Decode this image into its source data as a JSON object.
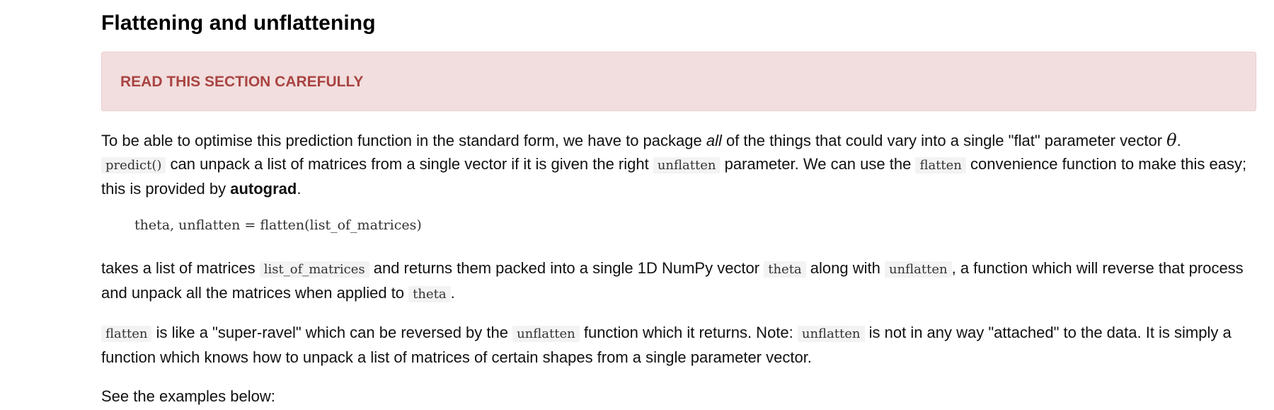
{
  "section": {
    "title": "Flattening and unflattening"
  },
  "alert": {
    "text": "READ THIS SECTION CAREFULLY"
  },
  "paragraph1": {
    "t1": "To be able to optimise this prediction function in the standard form, we have to package ",
    "em1": "all",
    "t2": " of the things that could vary into a single \"flat\" parameter vector ",
    "theta_symbol": "θ",
    "t3": ".",
    "code_predict": "predict()",
    "t4": " can unpack a list of matrices from a single vector if it is given the right ",
    "code_unflatten": "unflatten",
    "t5": " parameter. We can use the ",
    "code_flatten": "flatten",
    "t6": " convenience function to make this easy; this is provided by ",
    "strong1": "autograd",
    "t7": "."
  },
  "code_block": {
    "line": "theta, unflatten = flatten(list_of_matrices)"
  },
  "paragraph2": {
    "t1": "takes a list of matrices ",
    "code1": "list_of_matrices",
    "t2": " and returns them packed into a single 1D NumPy vector ",
    "code2": "theta",
    "t3": " along with ",
    "code3": "unflatten",
    "t4": ", a function which will reverse that process and unpack all the matrices when applied to ",
    "code4": "theta",
    "t5": "."
  },
  "paragraph3": {
    "code1": "flatten",
    "t1": " is like a \"super-ravel\" which can be reversed by the ",
    "code2": "unflatten",
    "t2": " function which it returns. Note: ",
    "code3": "unflatten",
    "t3": " is not in any way \"attached\" to the data. It is simply a function which knows how to unpack a list of matrices of certain shapes from a single parameter vector."
  },
  "paragraph4": {
    "text": "See the examples below:"
  },
  "colors": {
    "alert_bg": "#f2dede",
    "alert_border": "#ebccd1",
    "alert_text": "#a94442",
    "code_bg": "#f3f3f3"
  }
}
